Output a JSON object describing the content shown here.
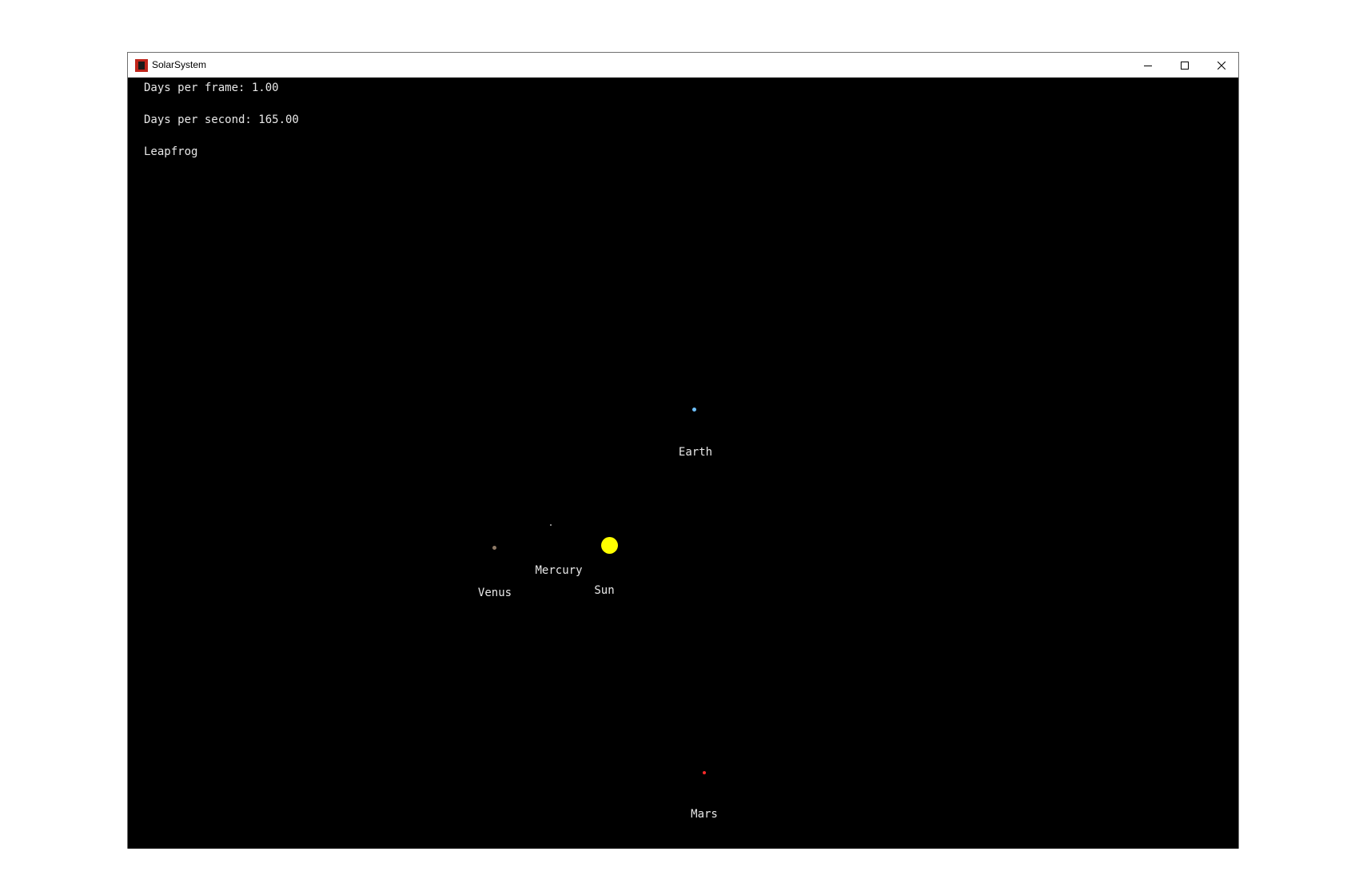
{
  "window": {
    "title": "SolarSystem"
  },
  "hud": {
    "days_per_frame": "Days per frame: 1.00",
    "days_per_second": "Days per second: 165.00",
    "integrator": "Leapfrog"
  },
  "bodies": {
    "sun": {
      "label": "Sun",
      "color": "#ffff00"
    },
    "mercury": {
      "label": "Mercury",
      "color": "#b0b0b0"
    },
    "venus": {
      "label": "Venus",
      "color": "#8f7a66"
    },
    "earth": {
      "label": "Earth",
      "color": "#6ec0ff"
    },
    "mars": {
      "label": "Mars",
      "color": "#ff2a2a"
    }
  },
  "icons": {
    "app": "solar-system-app-icon",
    "minimize": "minimize-icon",
    "maximize": "maximize-icon",
    "close": "close-icon"
  }
}
